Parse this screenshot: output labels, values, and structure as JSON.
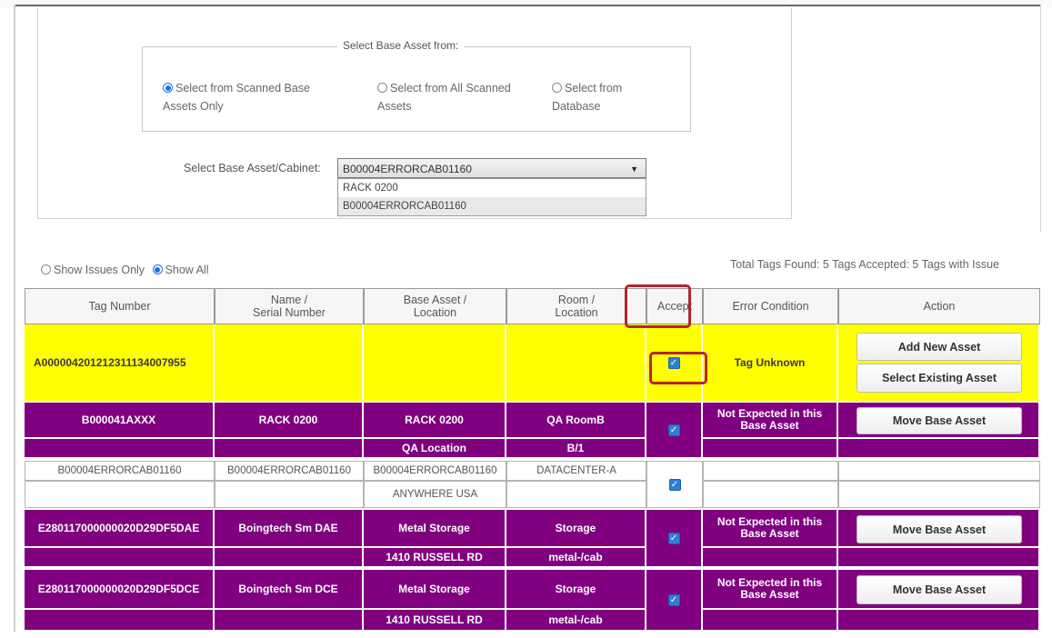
{
  "panel": {
    "legend": "Select Base Asset from:",
    "options": [
      {
        "line1": "Select from Scanned Base",
        "line2": "Assets Only",
        "selected": true
      },
      {
        "line1": "Select from All Scanned",
        "line2": "Assets",
        "selected": false
      },
      {
        "line1": "Select from",
        "line2": "Database",
        "selected": false
      }
    ],
    "cabinet_label": "Select Base Asset/Cabinet:",
    "cabinet_value": "B00004ERRORCAB01160",
    "dropdown_options": [
      "RACK 0200",
      "B00004ERRORCAB01160"
    ]
  },
  "filter": {
    "issues_only": "Show Issues Only",
    "show_all": "Show All",
    "totals": "Total Tags Found: 5  Tags Accepted: 5  Tags with Issue"
  },
  "table": {
    "headers": {
      "tag": "Tag Number",
      "name1": "Name /",
      "name2": "Serial Number",
      "base1": "Base Asset /",
      "base2": "Location",
      "room1": "Room /",
      "room2": "Location",
      "accept": "Accept",
      "error": "Error Condition",
      "action": "Action"
    },
    "rows": [
      {
        "tag": "A000004201212311134007955",
        "name": "",
        "base": "",
        "room": "",
        "error": "Tag Unknown",
        "actions": [
          "Add New Asset",
          "Select Existing Asset"
        ],
        "accepted": true
      },
      {
        "tag": "B000041AXXX",
        "name": "RACK 0200",
        "base": "RACK 0200",
        "base_loc": "QA Location",
        "room": "QA RoomB",
        "room_loc": "B/1",
        "error1": "Not Expected in this",
        "error2": "Base Asset",
        "action": "Move Base Asset",
        "accepted": true
      },
      {
        "tag": "B00004ERRORCAB01160",
        "name": "B00004ERRORCAB01160",
        "base": "B00004ERRORCAB01160",
        "base_loc": "ANYWHERE USA",
        "room": "DATACENTER-A",
        "accepted": true
      },
      {
        "tag": "E280117000000020D29DF5DAE",
        "name": "Boingtech Sm DAE",
        "base": "Metal Storage",
        "base_loc": "1410 RUSSELL RD",
        "room": "Storage",
        "room_loc": "metal-/cab",
        "error1": "Not Expected in this",
        "error2": "Base Asset",
        "action": "Move Base Asset",
        "accepted": true
      },
      {
        "tag": "E280117000000020D29DF5DCE",
        "name": "Boingtech Sm DCE",
        "base": "Metal Storage",
        "base_loc": "1410 RUSSELL RD",
        "room": "Storage",
        "room_loc": "metal-/cab",
        "error1": "Not Expected in this",
        "error2": "Base Asset",
        "action": "Move Base Asset",
        "accepted": true
      }
    ]
  },
  "colors": {
    "unknown_row": "#ffff00",
    "issue_row": "#800080",
    "highlight_box": "#b3262d",
    "checkbox": "#2f7fd6"
  }
}
